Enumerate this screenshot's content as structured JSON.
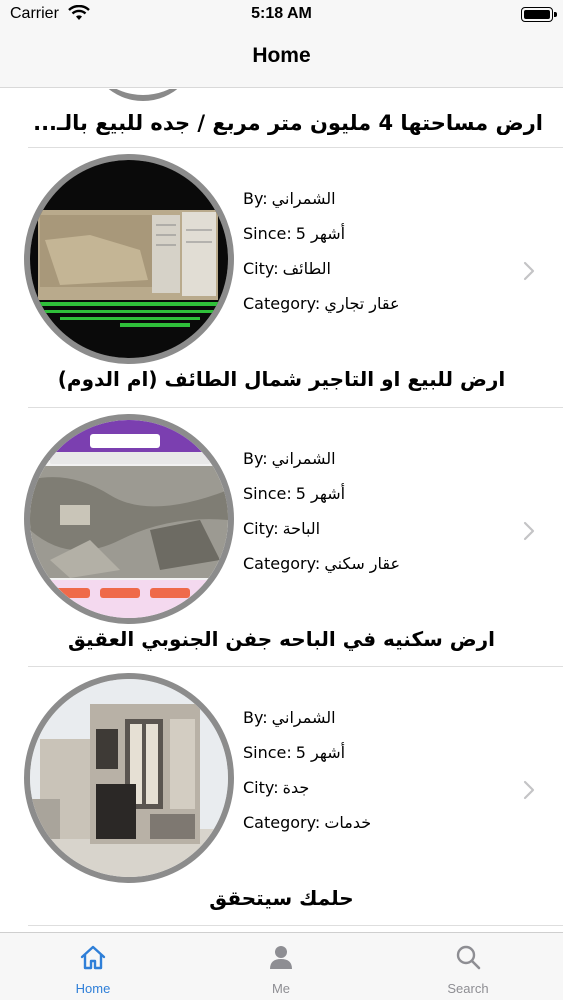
{
  "status_bar": {
    "carrier": "Carrier",
    "time": "5:18 AM"
  },
  "nav": {
    "title": "Home"
  },
  "previous_item": {
    "title": "ارض مساحتها 4 مليون متر مربع / جده للبيع بالـ..."
  },
  "listings": [
    {
      "by_label": "By:",
      "by_value": "الشمراني",
      "since_label": "Since:",
      "since_value": "5 أشهر",
      "city_label": "City:",
      "city_value": "الطائف",
      "category_label": "Category:",
      "category_value": "عقار تجاري",
      "title": "ارض للبيع او التاجير شمال الطائف (ام الدوم)",
      "thumb_icon": "land-document-photo"
    },
    {
      "by_label": "By:",
      "by_value": "الشمراني",
      "since_label": "Since:",
      "since_value": "5 أشهر",
      "city_label": "City:",
      "city_value": "الباحة",
      "category_label": "Category:",
      "category_value": "عقار سكني",
      "title": "ارض سكنيه في  الباحه جفن الجنوبي العقيق",
      "thumb_icon": "satellite-map-photo"
    },
    {
      "by_label": "By:",
      "by_value": "الشمراني",
      "since_label": "Since:",
      "since_value": "5 أشهر",
      "city_label": "City:",
      "city_value": "جدة",
      "category_label": "Category:",
      "category_value": "خدمات",
      "title": "حلمك سيتحقق",
      "thumb_icon": "villa-building-photo"
    }
  ],
  "tabs": [
    {
      "label": "Home",
      "icon": "home-icon",
      "selected": true
    },
    {
      "label": "Me",
      "icon": "person-icon",
      "selected": false
    },
    {
      "label": "Search",
      "icon": "search-icon",
      "selected": false
    }
  ],
  "colors": {
    "accent": "#2f7fd8",
    "inactive": "#8e8e93",
    "thumb_border": "#8c8c8c"
  }
}
